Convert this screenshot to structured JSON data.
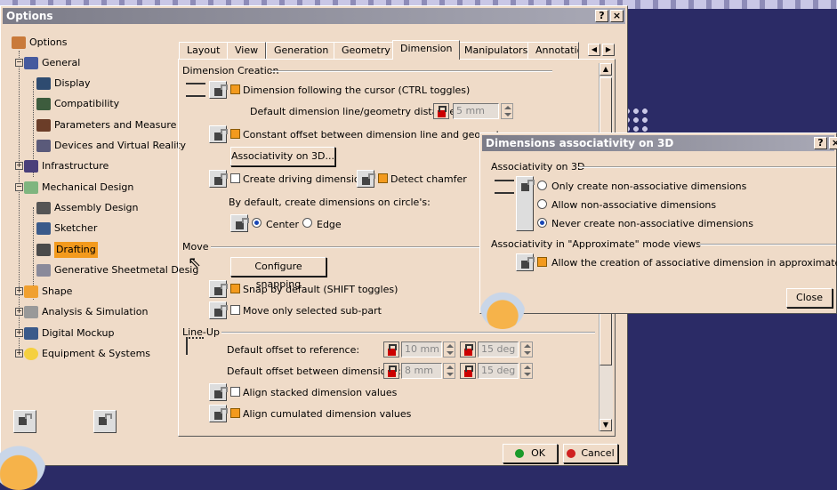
{
  "options": {
    "title": "Options",
    "title_help": "?",
    "title_close": "×",
    "tree": [
      {
        "label": "Options",
        "icon": "options-icon"
      },
      {
        "label": "General",
        "icon": "general-icon"
      },
      {
        "label": "Display",
        "icon": "display-icon"
      },
      {
        "label": "Compatibility",
        "icon": "compatibility-icon"
      },
      {
        "label": "Parameters and Measure",
        "icon": "parameters-icon"
      },
      {
        "label": "Devices and Virtual Reality",
        "icon": "devices-icon"
      },
      {
        "label": "Infrastructure",
        "icon": "infrastructure-icon"
      },
      {
        "label": "Mechanical Design",
        "icon": "mechanical-design-icon"
      },
      {
        "label": "Assembly Design",
        "icon": "assembly-icon"
      },
      {
        "label": "Sketcher",
        "icon": "sketcher-icon"
      },
      {
        "label": "Drafting",
        "icon": "drafting-icon"
      },
      {
        "label": "Generative Sheetmetal Desig",
        "icon": "sheetmetal-icon"
      },
      {
        "label": "Shape",
        "icon": "shape-icon"
      },
      {
        "label": "Analysis & Simulation",
        "icon": "analysis-icon"
      },
      {
        "label": "Digital Mockup",
        "icon": "mockup-icon"
      },
      {
        "label": "Equipment & Systems",
        "icon": "equipment-icon"
      }
    ],
    "tabs": [
      "Layout",
      "View",
      "Generation",
      "Geometry",
      "Dimension",
      "Manipulators",
      "Annotation"
    ],
    "dimension_creation": {
      "heading": "Dimension Creation",
      "follow_cursor": "Dimension following the cursor (CTRL toggles)",
      "default_distance_label": "Default dimension line/geometry distance:",
      "default_distance_value": "5 mm",
      "constant_offset": "Constant offset between dimension line and geometry",
      "associativity_button": "Associativity on 3D...",
      "create_driving": "Create driving dimension",
      "detect_chamfer": "Detect chamfer",
      "circle_label": "By default, create dimensions on circle's:",
      "center": "Center",
      "edge": "Edge"
    },
    "move": {
      "heading": "Move",
      "configure_snapping": "Configure snapping",
      "snap_default": "Snap by default (SHIFT toggles)",
      "move_selected": "Move only selected sub-part"
    },
    "lineup": {
      "heading": "Line-Up",
      "offset_reference_label": "Default offset to reference:",
      "offset_reference_value": "10 mm",
      "offset_reference_angle": "15 deg",
      "offset_between_label": "Default offset between dimensions:",
      "offset_between_value": "8 mm",
      "offset_between_angle": "15 deg",
      "align_stacked": "Align stacked dimension values",
      "align_cumulated": "Align cumulated dimension values"
    },
    "ok": "OK",
    "cancel": "Cancel"
  },
  "assoc_dialog": {
    "title": "Dimensions associativity on 3D",
    "title_help": "?",
    "title_close": "×",
    "section1": "Associativity on 3D",
    "opt1": "Only create non-associative dimensions",
    "opt2": "Allow non-associative dimensions",
    "opt3": "Never create non-associative dimensions",
    "section2": "Associativity in \"Approximate\" mode views",
    "approx": "Allow the creation of associative dimension in approximate views",
    "close": "Close"
  }
}
